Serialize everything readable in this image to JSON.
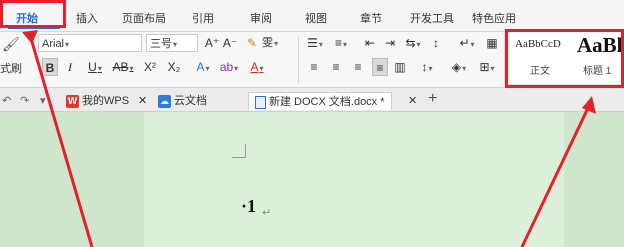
{
  "menu": {
    "tabs": [
      "开始",
      "插入",
      "页面布局",
      "引用",
      "审阅",
      "视图",
      "章节",
      "开发工具",
      "特色应用"
    ]
  },
  "ribbon": {
    "format_painter_label": "式刷",
    "font_name": "Arial",
    "font_size": "三号",
    "grow_font": "A⁺",
    "shrink_font": "A⁻",
    "style_samples": {
      "sample1": "AaBbCcD",
      "sample2": "AaBl"
    },
    "style_labels": {
      "style1": "正文",
      "style2": "标题 1"
    },
    "bold": "B",
    "italic": "I",
    "underline": "U",
    "strikethrough": "AB",
    "superscript": "X²",
    "subscript": "X₂",
    "font_color": "A",
    "wen": "雯"
  },
  "doctabs": {
    "wps": "我的WPS",
    "cloud": "云文档",
    "current": "新建 DOCX 文档.docx *",
    "add": "+"
  },
  "document": {
    "list_number": "·1",
    "paragraph_mark": "↵"
  },
  "colors": {
    "accent": "#2a6fd6",
    "annotation": "#e5202b",
    "workspace": "#cfe5cc"
  }
}
